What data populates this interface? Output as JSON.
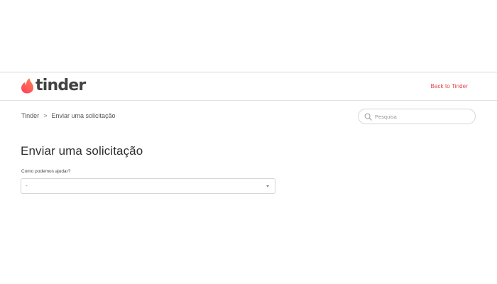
{
  "header": {
    "brand": "tinder",
    "back_link": "Back to Tinder"
  },
  "breadcrumb": {
    "items": [
      "Tinder",
      "Enviar uma solicitação"
    ],
    "separator": ">"
  },
  "search": {
    "placeholder": "Pesquisa"
  },
  "main": {
    "title": "Enviar uma solicitação",
    "field_label": "Como podemos ajudar?",
    "select_value": "-"
  },
  "colors": {
    "brand_gradient_start": "#fd5068",
    "brand_gradient_end": "#ff7854",
    "link": "#e2464f",
    "text": "#2f2f2f",
    "border": "#d6d6d6"
  },
  "icons": {
    "logo": "flame-icon",
    "search": "search-icon",
    "select_arrow": "chevron-down-icon"
  }
}
